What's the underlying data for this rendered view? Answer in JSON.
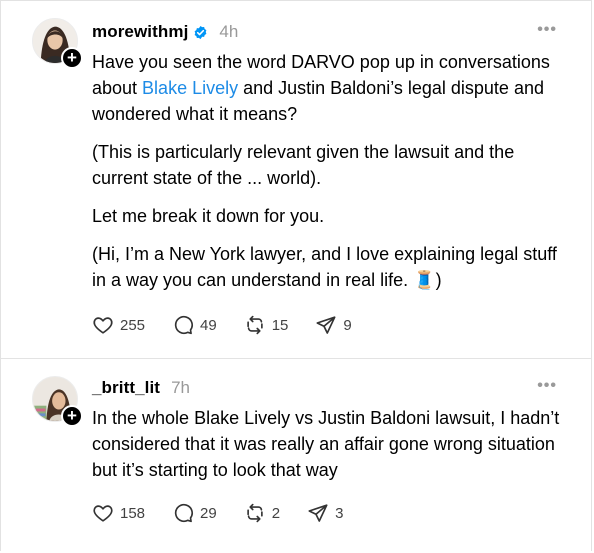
{
  "posts": [
    {
      "username": "morewithmj",
      "time": "4h",
      "more_icon": "more-horizontal-icon",
      "paragraphs": [
        {
          "pre": "Have you seen the word DARVO pop up in conversations about ",
          "link": "Blake Lively",
          "post": " and Justin Baldoni’s legal dispute and wondered what it means?"
        },
        {
          "pre": "(This is particularly relevant given the lawsuit and the current state of the ... world)."
        },
        {
          "pre": "Let me break it down for you."
        },
        {
          "pre": "(Hi, I’m a New York lawyer, and I love explaining legal stuff in a way you can understand in real life. 🧵)"
        }
      ],
      "likes": "255",
      "comments": "49",
      "reposts": "15",
      "shares": "9"
    },
    {
      "username": "_britt_lit",
      "time": "7h",
      "more_icon": "more-horizontal-icon",
      "paragraphs": [
        {
          "pre": "In the whole Blake Lively vs Justin Baldoni lawsuit, I hadn’t considered that it was really an affair gone wrong situation but it’s starting to look that way"
        }
      ],
      "likes": "158",
      "comments": "29",
      "reposts": "2",
      "shares": "3"
    }
  ],
  "colors": {
    "link": "#1d8be6",
    "verified": "#0095f6",
    "muted": "#999999"
  }
}
